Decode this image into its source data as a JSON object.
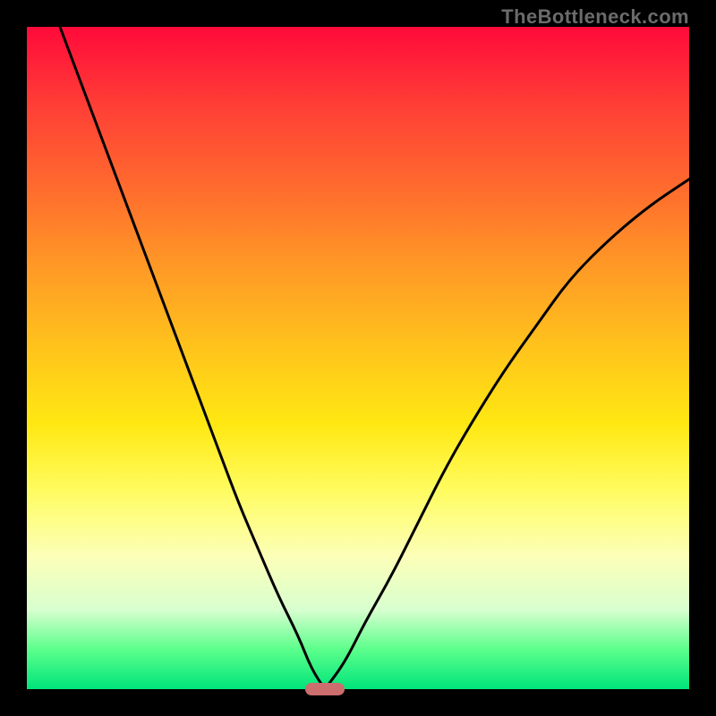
{
  "watermark": "TheBottleneck.com",
  "colors": {
    "frame": "#000000",
    "pill": "#cc6d6e",
    "curve": "#000000"
  },
  "chart_data": {
    "type": "line",
    "title": "",
    "xlabel": "",
    "ylabel": "",
    "xlim": [
      0,
      100
    ],
    "ylim": [
      0,
      100
    ],
    "grid": false,
    "legend": false,
    "note": "Values are relative; chart has no visible axis ticks. Vertical axis reads as bottleneck/mismatch level (0 = green/good at bottom, 100 = red/bad at top). Horizontal axis is an implied component-balance ratio. Curve reaches its minimum near x≈45.",
    "series": [
      {
        "name": "left-branch",
        "x": [
          5,
          8,
          11,
          14,
          17,
          20,
          23,
          26,
          29,
          32,
          35,
          38,
          41,
          43,
          45
        ],
        "y": [
          100,
          92,
          84,
          76,
          68,
          60,
          52,
          44,
          36,
          28,
          21,
          14,
          8,
          3,
          0
        ]
      },
      {
        "name": "right-branch",
        "x": [
          45,
          48,
          51,
          55,
          59,
          63,
          67,
          72,
          77,
          82,
          88,
          94,
          100
        ],
        "y": [
          0,
          4,
          10,
          17,
          25,
          33,
          40,
          48,
          55,
          62,
          68,
          73,
          77
        ]
      }
    ],
    "optimum_marker": {
      "x": 45,
      "y": 0,
      "width": 6,
      "height": 2
    }
  }
}
